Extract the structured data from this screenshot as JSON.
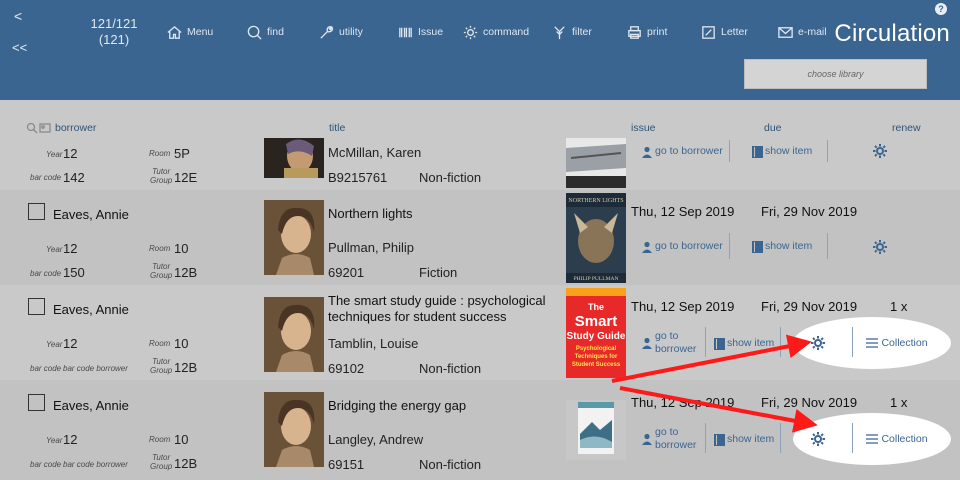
{
  "header": {
    "nav_back": "<",
    "nav_first": "<<",
    "counter_line1": "121/121",
    "counter_line2": "(121)",
    "toolbar": [
      {
        "label": "Menu",
        "icon": "home-icon"
      },
      {
        "label": "find",
        "icon": "search-icon"
      },
      {
        "label": "utility",
        "icon": "wrench-icon"
      },
      {
        "label": "Issue",
        "icon": "barcode-icon"
      },
      {
        "label": "command",
        "icon": "gear-icon"
      },
      {
        "label": "filter",
        "icon": "filter-icon"
      },
      {
        "label": "print",
        "icon": "printer-icon"
      },
      {
        "label": "Letter",
        "icon": "pencil-icon"
      },
      {
        "label": "e-mail",
        "icon": "envelope-icon"
      }
    ],
    "app_title": "Circulation",
    "help": "?",
    "library_placeholder": "choose library"
  },
  "columns": {
    "borrower": "borrower",
    "title": "title",
    "issue": "issue",
    "due": "due",
    "renew": "renew"
  },
  "labels": {
    "year": "Year",
    "room": "Room",
    "bar_code": "bar code",
    "tutor_group_1": "Tutor",
    "tutor_group_2": "Group",
    "go_to_borrower": "go to borrower",
    "go_to_1": "go to",
    "go_to_2": "borrower",
    "show_item": "show item",
    "collection": "Collection",
    "bar_code_borrower": "bar code borrower"
  },
  "rows": [
    {
      "name": "",
      "year": "12",
      "room": "5P",
      "bar_code": "142",
      "tutor_group": "12E",
      "title": "",
      "author": "McMillan, Karen",
      "item_barcode": "B9215761",
      "category": "Non-fiction",
      "issue": "",
      "due": "",
      "renew": ""
    },
    {
      "name": "Eaves, Annie",
      "year": "12",
      "room": "10",
      "bar_code": "150",
      "tutor_group": "12B",
      "title": "Northern lights",
      "author": "Pullman, Philip",
      "item_barcode": "69201",
      "category": "Fiction",
      "issue": "Thu, 12 Sep 2019",
      "due": "Fri, 29 Nov 2019",
      "renew": ""
    },
    {
      "name": "Eaves, Annie",
      "year": "12",
      "room": "10",
      "bar_code": "bar code borrower",
      "tutor_group": "12B",
      "title": "The smart study guide : psychological techniques for student success",
      "author": "Tamblin, Louise",
      "item_barcode": "69102",
      "category": "Non-fiction",
      "issue": "Thu, 12 Sep 2019",
      "due": "Fri, 29 Nov 2019",
      "renew": "1 x"
    },
    {
      "name": "Eaves, Annie",
      "year": "12",
      "room": "10",
      "bar_code": "bar code borrower",
      "tutor_group": "12B",
      "title": "Bridging the energy gap",
      "author": "Langley, Andrew",
      "item_barcode": "69151",
      "category": "Non-fiction",
      "issue": "Thu, 12 Sep 2019",
      "due": "Fri, 29 Nov 2019",
      "renew": "1 x"
    }
  ],
  "covers": {
    "northern_lights_1": "NORTHERN LIGHTS",
    "northern_lights_2": "PHILIP PULLMAN",
    "smart_1": "The",
    "smart_2": "Smart",
    "smart_3": "Study Guide",
    "smart_4": "Psychological",
    "smart_5": "Techniques for",
    "smart_6": "Student Success"
  },
  "colors": {
    "header_bg": "#3b6591",
    "page_bg": "#c9c9c9",
    "link": "#3b6591",
    "annotation_arrow": "#ff1a1a"
  }
}
